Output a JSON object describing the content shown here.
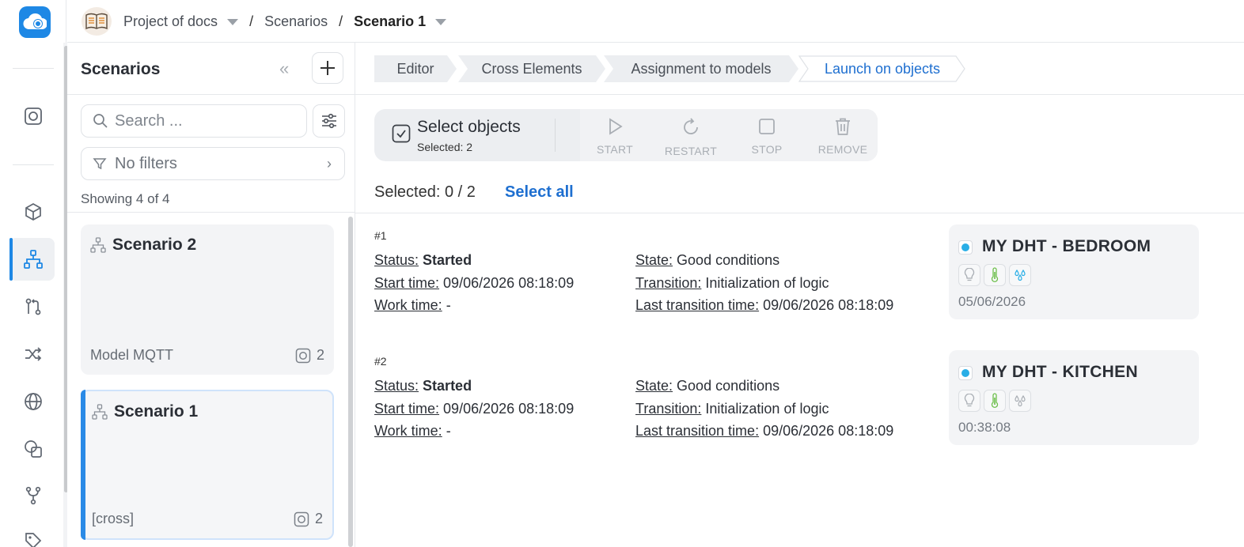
{
  "breadcrumbs": {
    "project": "Project of docs",
    "section": "Scenarios",
    "current": "Scenario 1",
    "separator": "/"
  },
  "sidebar": {
    "nav_icons": [
      "device-icon",
      "cube-icon",
      "hierarchy-icon",
      "flow-icon",
      "shuffle-icon",
      "globe-icon",
      "shapes-icon",
      "branch-icon",
      "tag-icon"
    ],
    "active_item": "hierarchy-icon",
    "accent": "#1e88e5"
  },
  "scenarios_panel": {
    "title": "Scenarios",
    "search_placeholder": "Search ...",
    "filters_label": "No filters",
    "showing": "Showing 4 of 4",
    "items": [
      {
        "name": "Scenario 2",
        "model": "Model MQTT",
        "count": "2",
        "selected": false
      },
      {
        "name": "Scenario 1",
        "model": "[cross]",
        "count": "2",
        "selected": true
      }
    ]
  },
  "steps": [
    {
      "label": "Editor",
      "active": false
    },
    {
      "label": "Cross Elements",
      "active": false
    },
    {
      "label": "Assignment to models",
      "active": false
    },
    {
      "label": "Launch on objects",
      "active": true
    }
  ],
  "toolbar": {
    "select_title": "Select objects",
    "select_sub": "Selected: 2",
    "actions": [
      {
        "label": "START",
        "icon": "play-icon"
      },
      {
        "label": "RESTART",
        "icon": "restart-icon"
      },
      {
        "label": "STOP",
        "icon": "stop-icon"
      },
      {
        "label": "REMOVE",
        "icon": "trash-icon"
      }
    ]
  },
  "selection": {
    "label": "Selected: 0 / 2",
    "select_all": "Select all"
  },
  "labels": {
    "status": "Status:",
    "start_time": "Start time:",
    "work_time": "Work time:",
    "state": "State:",
    "transition": "Transition:",
    "last_transition_time": "Last transition time:"
  },
  "objects": [
    {
      "index": "#1",
      "status": "Started",
      "start_time": "09/06/2026 08:18:09",
      "work_time": "-",
      "state": "Good conditions",
      "transition": "Initialization of logic",
      "last_transition_time": "09/06/2026 08:18:09",
      "device_name": "MY DHT - BEDROOM",
      "device_date": "05/06/2026",
      "badges": [
        "bulb-icon",
        "thermometer-icon",
        "drops-icon"
      ]
    },
    {
      "index": "#2",
      "status": "Started",
      "start_time": "09/06/2026 08:18:09",
      "work_time": "-",
      "state": "Good conditions",
      "transition": "Initialization of logic",
      "last_transition_time": "09/06/2026 08:18:09",
      "device_name": "MY DHT - KITCHEN",
      "device_date": "00:38:08",
      "badges": [
        "bulb-icon",
        "thermometer-icon",
        "drops-icon"
      ]
    }
  ]
}
